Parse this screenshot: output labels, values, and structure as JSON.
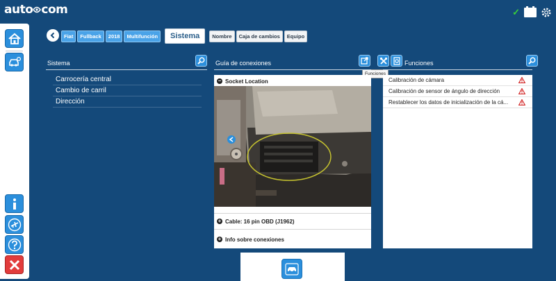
{
  "app": {
    "brand": "auto com",
    "status_check": "✓"
  },
  "breadcrumb": {
    "items": [
      {
        "label": "Fiat"
      },
      {
        "label": "Fullback"
      },
      {
        "label": "2018"
      },
      {
        "label": "Multifunción"
      }
    ],
    "active": "Sistema",
    "filters": [
      {
        "label": "Nombre"
      },
      {
        "label": "Caja de cambios"
      },
      {
        "label": "Equipo"
      }
    ]
  },
  "sistema": {
    "title": "Sistema",
    "items": [
      {
        "label": "Carrocería central"
      },
      {
        "label": "Cambio de carril"
      },
      {
        "label": "Dirección"
      }
    ]
  },
  "guide": {
    "title": "Guía de conexiones",
    "sections": [
      {
        "label": "Socket Location",
        "state": "−"
      },
      {
        "label": "Cable: 16 pin OBD (J1962)",
        "state": "+"
      },
      {
        "label": "Info sobre conexiones",
        "state": "+"
      }
    ]
  },
  "tooltip": {
    "text": "Funciones"
  },
  "funciones": {
    "title": "Funciones",
    "items": [
      {
        "label": "Calibración de cámara"
      },
      {
        "label": "Calibración de sensor de ángulo de dirección"
      },
      {
        "label": "Restablecer los datos de inicialización de la cá..."
      }
    ]
  },
  "icons": {
    "rail": [
      "home-icon",
      "vehicle-diagnostics-icon",
      "info-icon",
      "flight-mode-icon",
      "help-icon",
      "exit-icon"
    ],
    "accent": "#2b8fdc",
    "warning": "#d11f1f",
    "background": "#14497a"
  }
}
